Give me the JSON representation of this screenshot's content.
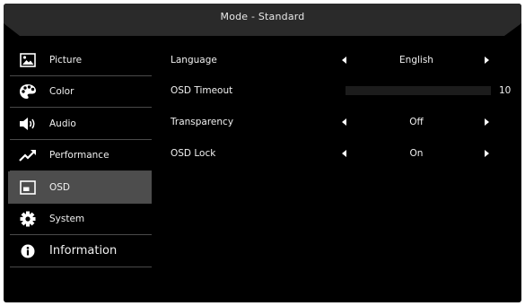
{
  "header": {
    "title": "Mode - Standard"
  },
  "sidebar": {
    "items": [
      {
        "label": "Picture",
        "icon": "picture-icon"
      },
      {
        "label": "Color",
        "icon": "palette-icon"
      },
      {
        "label": "Audio",
        "icon": "speaker-icon"
      },
      {
        "label": "Performance",
        "icon": "trend-arrow-icon"
      },
      {
        "label": "OSD",
        "icon": "osd-window-icon",
        "selected": true
      },
      {
        "label": "System",
        "icon": "gear-icon"
      },
      {
        "label": "Information",
        "icon": "info-icon"
      }
    ]
  },
  "settings": {
    "language": {
      "label": "Language",
      "value": "English"
    },
    "osd_timeout": {
      "label": "OSD Timeout",
      "value": "10",
      "level": 0.1
    },
    "transparency": {
      "label": "Transparency",
      "value": "Off"
    },
    "osd_lock": {
      "label": "OSD Lock",
      "value": "On"
    }
  },
  "colors": {
    "background": "#000000",
    "header": "#2a2a2a",
    "selected_item": "#4d4d4d",
    "divider": "#4a4a4a",
    "slider_track": "#1c1c1c"
  }
}
